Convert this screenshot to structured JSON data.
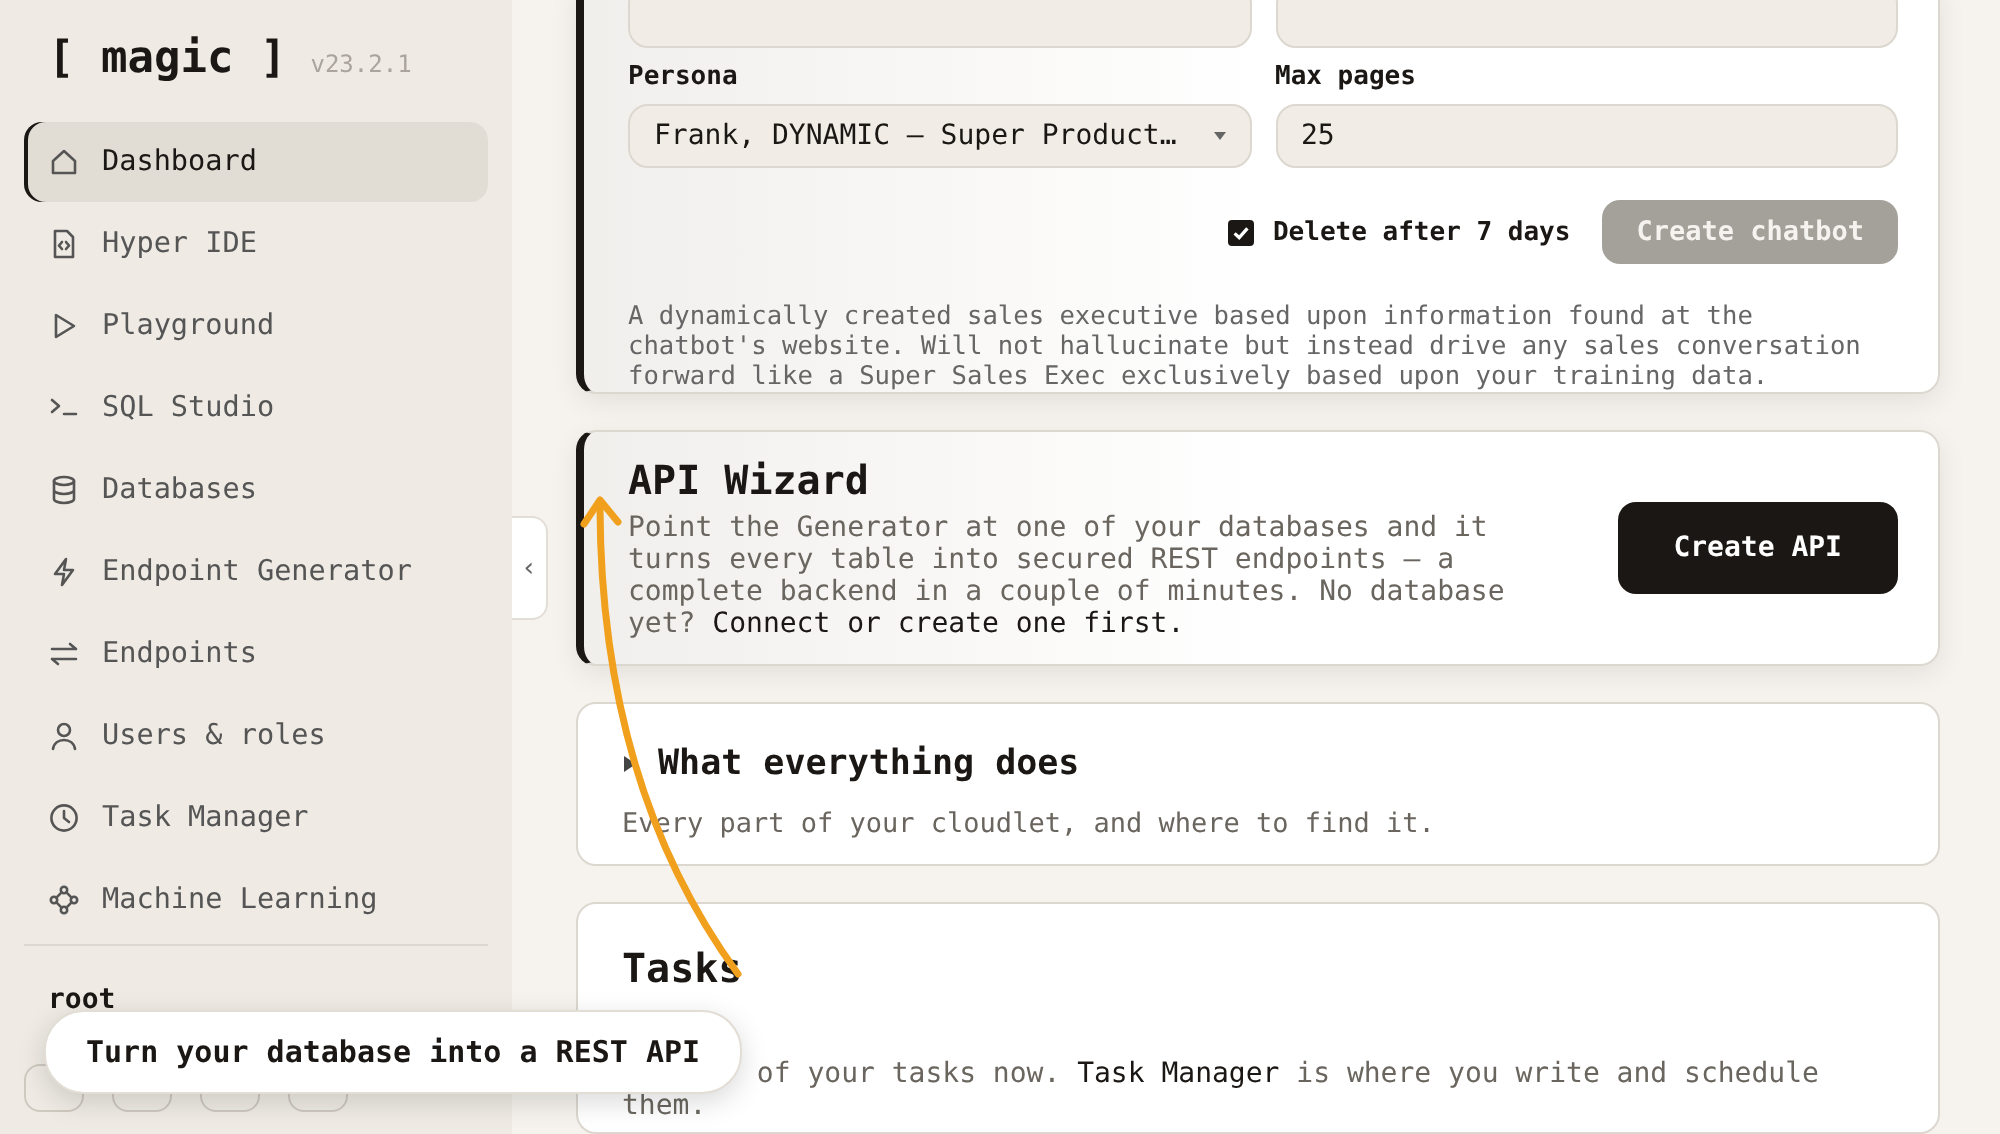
{
  "sidebar": {
    "logo": "[ magic ]",
    "version": "v23.2.1",
    "items": [
      {
        "label": "Dashboard",
        "kind": "home",
        "selected": true
      },
      {
        "label": "Hyper IDE",
        "kind": "file-code",
        "selected": false
      },
      {
        "label": "Playground",
        "kind": "play",
        "selected": false
      },
      {
        "label": "SQL Studio",
        "kind": "terminal",
        "selected": false
      },
      {
        "label": "Databases",
        "kind": "database",
        "selected": false
      },
      {
        "label": "Endpoint Generator",
        "kind": "bolt",
        "selected": false
      },
      {
        "label": "Endpoints",
        "kind": "arrows",
        "selected": false
      },
      {
        "label": "Users & roles",
        "kind": "user",
        "selected": false
      },
      {
        "label": "Task Manager",
        "kind": "clock",
        "selected": false
      },
      {
        "label": "Machine Learning",
        "kind": "nodes",
        "selected": false
      }
    ],
    "user": {
      "name": "root"
    },
    "collapse_button": "‹"
  },
  "chatbot_card": {
    "highlighted": true,
    "persona_label": "Persona",
    "persona_value": "Frank, DYNAMIC – Super Product…",
    "max_pages_label": "Max pages",
    "max_pages_value": "25",
    "delete_checkbox": {
      "label": "Delete after 7 days",
      "checked": true
    },
    "create_button": {
      "label": "Create chatbot",
      "disabled": true
    },
    "description": "A dynamically created sales executive based upon information found at the chatbot's website. Will not hallucinate but instead drive any sales conversation forward like a Super Sales Exec exclusively based upon your training data."
  },
  "api_wizard": {
    "highlighted": true,
    "title": "API Wizard",
    "text": "Point the Generator at one of your databases and it turns every table into secured REST endpoints — a complete backend in a couple of minutes. No database yet?",
    "link": "Connect or create one first.",
    "button": "Create API"
  },
  "overview": {
    "title": "What everything does",
    "expanded": false,
    "text": "Every part of your cloudlet, and where to find it."
  },
  "tasks": {
    "title": "Tasks",
    "text_before": "of your tasks now.",
    "link": "Task Manager",
    "text_after": "is where you write and schedule them."
  },
  "tooltip": {
    "text": "Turn your database into a REST API"
  }
}
